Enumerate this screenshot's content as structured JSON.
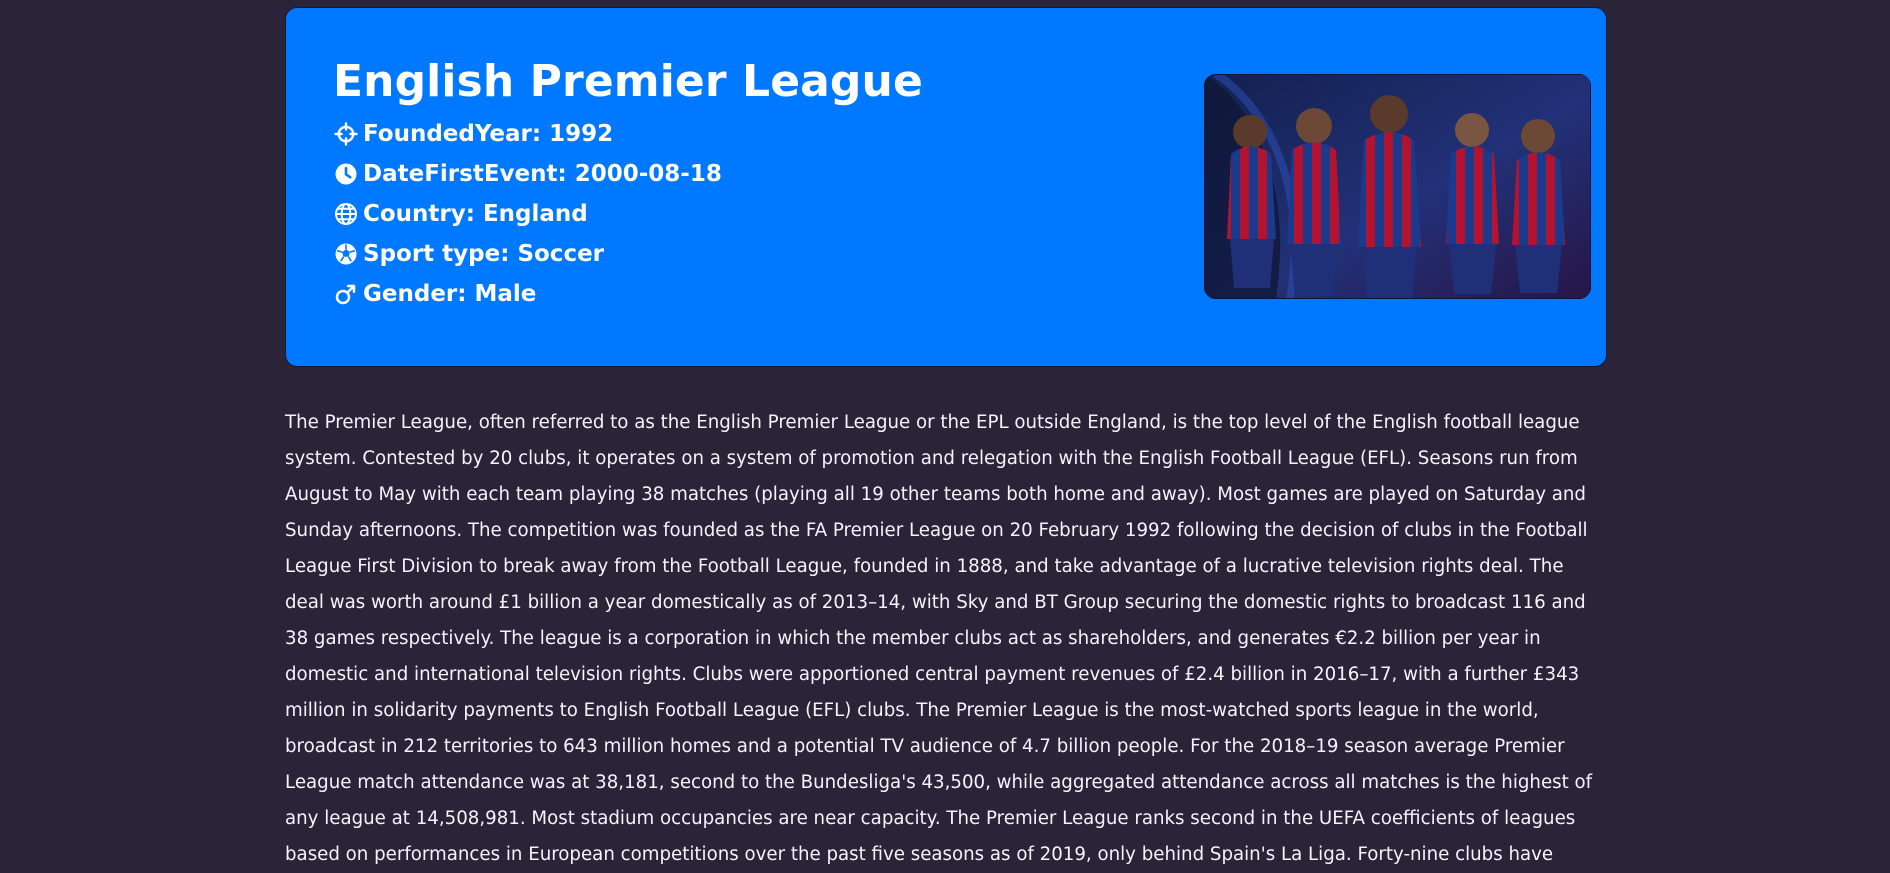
{
  "league": {
    "title": "English Premier League",
    "image_alt": "Players wearing red and blue striped kits"
  },
  "facts": [
    {
      "icon": "crosshair-icon",
      "label": "FoundedYear:",
      "value": "1992"
    },
    {
      "icon": "clock-icon",
      "label": "DateFirstEvent:",
      "value": "2000-08-18"
    },
    {
      "icon": "globe-icon",
      "label": "Country:",
      "value": "England"
    },
    {
      "icon": "soccer-ball-icon",
      "label": "Sport type:",
      "value": "Soccer"
    },
    {
      "icon": "male-icon",
      "label": "Gender:",
      "value": "Male"
    }
  ],
  "description": {
    "text": "The Premier League, often referred to as the English Premier League or the EPL outside England, is the top level of the English football league system. Contested by 20 clubs, it operates on a system of promotion and relegation with the English Football League (EFL). Seasons run from August to May with each team playing 38 matches (playing all 19 other teams both home and away). Most games are played on Saturday and Sunday afternoons. The competition was founded as the FA Premier League on 20 February 1992 following the decision of clubs in the Football League First Division to break away from the Football League, founded in 1888, and take advantage of a lucrative television rights deal. The deal was worth around £1 billion a year domestically as of 2013–14, with Sky and BT Group securing the domestic rights to broadcast 116 and 38 games respectively. The league is a corporation in which the member clubs act as shareholders, and generates €2.2 billion per year in domestic and international television rights. Clubs were apportioned central payment revenues of £2.4 billion in 2016–17, with a further £343 million in solidarity payments to English Football League (EFL) clubs. The Premier League is the most-watched sports league in the world, broadcast in 212 territories to 643 million homes and a potential TV audience of 4.7 billion people. For the 2018–19 season average Premier League match attendance was at 38,181, second to the Bundesliga's 43,500, while aggregated attendance across all matches is the highest of any league at 14,508,981. Most stadium occupancies are near capacity. The Premier League ranks second in the UEFA coefficients of leagues based on performances in European competitions over the past five seasons as of 2019, only behind Spain's La Liga. Forty-nine clubs have"
  },
  "colors": {
    "page_background": "#2b2338",
    "hero_background": "#0078ff",
    "text": "#ffffff",
    "kit_blue": "#1b3a8c",
    "kit_red": "#b4132f"
  }
}
